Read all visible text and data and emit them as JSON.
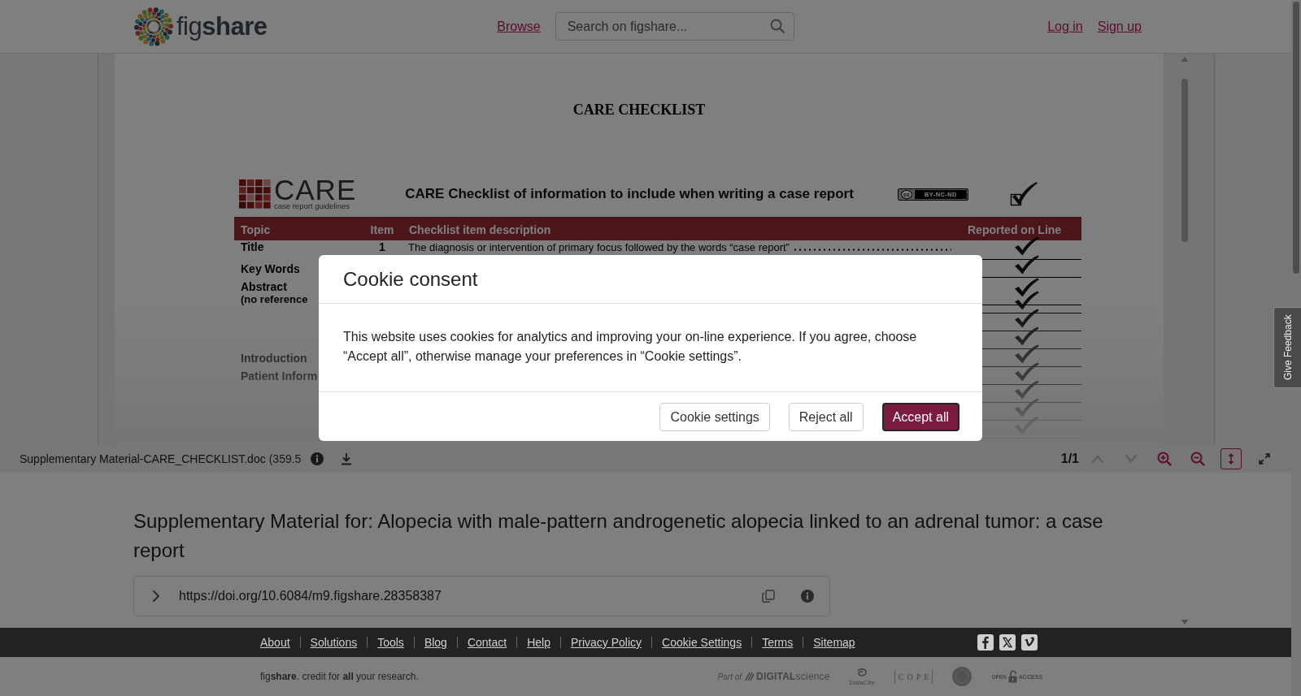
{
  "header": {
    "logo": "fig**share**",
    "nav": [
      "Browse"
    ],
    "search": {
      "placeholder": "Search on figshare..."
    },
    "account_links": [
      "Log in",
      "Sign up"
    ]
  },
  "viewer": {
    "document": {
      "title": "CARE CHECKLIST",
      "care_logo": {
        "wordmark": "CARE",
        "tagline": "case report guidelines"
      },
      "heading": "CARE Checklist of information to include when writing a case report",
      "license_badge": {
        "symbol": "cc",
        "label": "BY-NC-ND"
      },
      "heading_checked": true,
      "columns": [
        "Topic",
        "Item",
        "Checklist item description",
        "Reported on Line"
      ],
      "rows": [
        {
          "topic": "Title",
          "item": "1",
          "description": "The diagnosis or intervention of primary focus followed by the words “case report”",
          "checked": true
        },
        {
          "topic": "Key Words",
          "checked": true
        },
        {
          "topic": "Abstract",
          "note": "(no reference",
          "checked": true
        },
        {
          "checked": true
        },
        {
          "checked": true
        },
        {
          "checked": true
        },
        {
          "topic": "Introduction",
          "checked": true
        },
        {
          "topic": "Patient Inform",
          "checked": true
        },
        {
          "checked": true
        },
        {
          "checked": true
        },
        {
          "checked": true
        }
      ]
    },
    "toolbar": {
      "file_name": "Supplementary Material-CARE_CHECKLIST.doc",
      "file_size": "(359.5",
      "page": "1/1",
      "tools": [
        {
          "kind": "prev",
          "disabled": true,
          "selected": false
        },
        {
          "kind": "next",
          "disabled": true,
          "selected": false
        },
        {
          "kind": "zoom_in",
          "disabled": false,
          "selected": false
        },
        {
          "kind": "zoom_out",
          "disabled": false,
          "selected": false
        },
        {
          "kind": "fit_height",
          "disabled": false,
          "selected": true
        },
        {
          "kind": "fullscreen",
          "disabled": false,
          "selected": false
        }
      ]
    }
  },
  "item": {
    "title": "Supplementary Material for: Alopecia with male-pattern androgenetic alopecia linked to an adrenal tumor: a case report",
    "doi": "https://doi.org/10.6084/m9.figshare.28358387"
  },
  "footer": {
    "links": [
      "About",
      "Solutions",
      "Tools",
      "Blog",
      "Contact",
      "Help",
      "Privacy Policy",
      "Cookie Settings",
      "Terms",
      "Sitemap"
    ],
    "social": [
      {
        "kind": "facebook"
      },
      {
        "kind": "x"
      },
      {
        "kind": "vimeo"
      }
    ],
    "tagline": "fig**share**. credit for **all** your research.",
    "partners": [
      {
        "kind": "digital_science",
        "prefix": "Part of",
        "name": "**DIGITAL**science"
      },
      {
        "kind": "datacite",
        "label": "DataCite"
      },
      {
        "kind": "cope",
        "label": "COPE"
      },
      {
        "kind": "seal"
      },
      {
        "kind": "open_access",
        "labels": [
          "OPEN",
          "ACCESS"
        ]
      }
    ]
  },
  "feedback_tab": {
    "label": "Give Feedback"
  },
  "cookie_dialog": {
    "title": "Cookie consent",
    "message": "This website uses cookies for analytics and improving your on-line experience. If you agree, choose “Accept all”, otherwise manage your preferences in “Cookie settings”.",
    "buttons": [
      {
        "label": "Cookie settings",
        "kind": "secondary",
        "focused": false
      },
      {
        "label": "Reject all",
        "kind": "secondary",
        "focused": false
      },
      {
        "label": "Accept all",
        "kind": "primary",
        "focused": true
      }
    ]
  }
}
